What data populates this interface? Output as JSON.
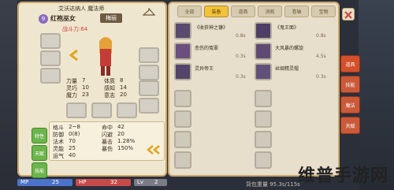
{
  "character": {
    "title": "艾沃达纳人 魔法师",
    "level": "9",
    "name": "红袍巫女",
    "tag": "梅丽",
    "battle_power_label": "战斗力:64"
  },
  "stats_main": [
    {
      "label": "力量",
      "value": "7"
    },
    {
      "label": "体质",
      "value": "8"
    },
    {
      "label": "灵巧",
      "value": "10"
    },
    {
      "label": "感知",
      "value": "14"
    },
    {
      "label": "魔力",
      "value": "23"
    },
    {
      "label": "意志",
      "value": "20"
    }
  ],
  "stats_detail": [
    {
      "label": "格斗",
      "value": "2~8",
      "label2": "命中",
      "value2": "42"
    },
    {
      "label": "防御",
      "value": "0(8)",
      "label2": "闪避",
      "value2": "20"
    },
    {
      "label": "法术",
      "value": "70",
      "label2": "暴击",
      "value2": "1.28%"
    },
    {
      "label": "灵能",
      "value": "25",
      "label2": "暴伤",
      "value2": "150%"
    },
    {
      "label": "运气",
      "value": "40",
      "label2": "",
      "value2": ""
    }
  ],
  "green_buttons": [
    "特性",
    "天赋",
    "技能"
  ],
  "bottom_bars": {
    "mp_label": "MP",
    "mp_value": "25",
    "hp_label": "HP",
    "hp_value": "32",
    "lv_label": "Lv",
    "lv_value": "2"
  },
  "inventory": {
    "tabs": [
      "全部",
      "装备",
      "道具",
      "消耗",
      "卷轴",
      "宝物"
    ],
    "active_tab_index": 1,
    "items": [
      {
        "name": "《收获神之镰》",
        "count": "0.8s"
      },
      {
        "name": "《鬼王面》",
        "count": "0.8s"
      },
      {
        "name": "悲伤的冤罪",
        "count": "0.3s"
      },
      {
        "name": "大风暴的螺旋",
        "count": "4.5s"
      },
      {
        "name": "灵异帝王",
        "count": "0.3s"
      },
      {
        "name": "丝绸精灵帽",
        "count": "0.3s"
      }
    ],
    "weight_label": "背包重量 95.3s/115s"
  },
  "side_buttons": [
    "道具",
    "技能",
    "魔法",
    "天赋"
  ],
  "close_icon": "close-icon",
  "watermark": "维普手游网",
  "colors": {
    "accent_gold": "#f1c23b",
    "panel_bg": "#efe6cf",
    "side_button_red": "#ca5a3a",
    "mp_blue": "#4a73c9",
    "hp_red": "#c94a4a"
  }
}
